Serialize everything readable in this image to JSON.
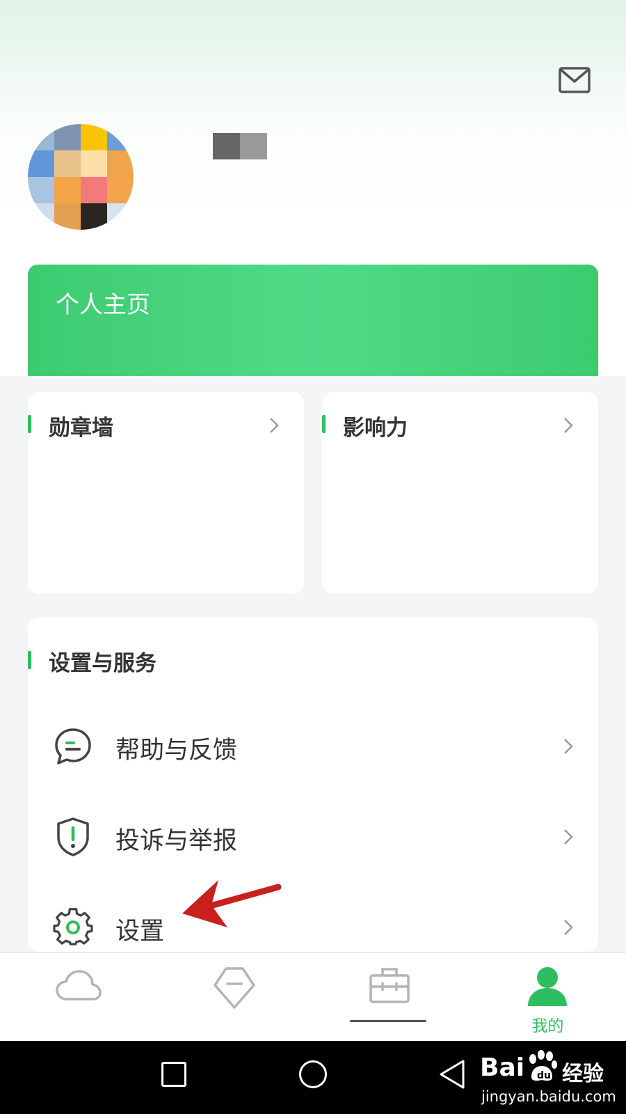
{
  "header": {
    "mail_icon": "mail-icon"
  },
  "profile": {
    "avatar": "avatar-pixelated",
    "home_label": "个人主页"
  },
  "cards": [
    {
      "title": "勋章墙"
    },
    {
      "title": "影响力"
    }
  ],
  "services": {
    "title": "设置与服务",
    "items": [
      {
        "label": "帮助与反馈",
        "icon": "chat-feedback-icon"
      },
      {
        "label": "投诉与举报",
        "icon": "shield-alert-icon"
      },
      {
        "label": "设置",
        "icon": "gear-icon"
      }
    ]
  },
  "tabbar": {
    "tabs": [
      {
        "icon": "cloud-icon"
      },
      {
        "icon": "tag-icon"
      },
      {
        "icon": "briefcase-icon"
      },
      {
        "icon": "person-icon",
        "label": "我的",
        "active": true
      }
    ]
  },
  "watermark": {
    "logo": "Bai",
    "text": "经验",
    "url": "jingyan.baidu.com"
  },
  "colors": {
    "accent": "#2fbe5f",
    "home_card": "#46d27c",
    "arrow": "#c8211d"
  }
}
